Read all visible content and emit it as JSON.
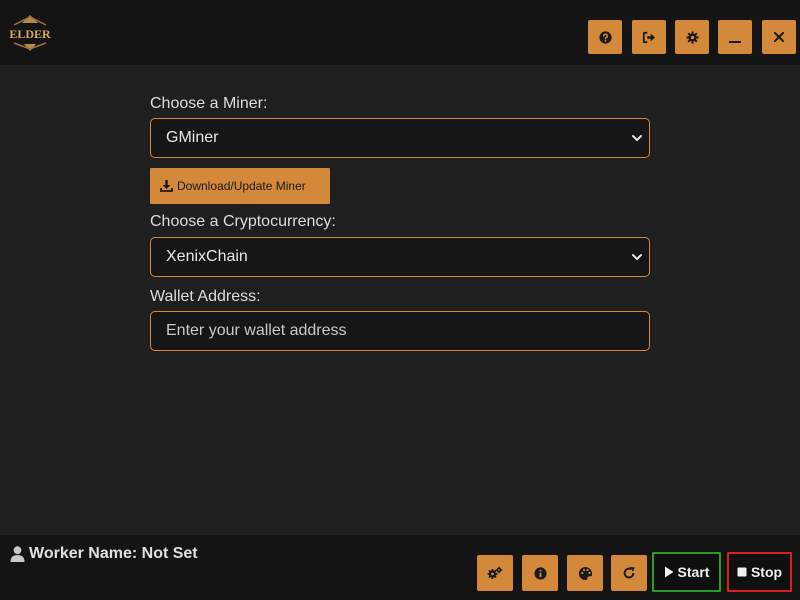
{
  "header": {
    "logo_text": "ELDER",
    "buttons": [
      {
        "name": "help",
        "icon": "question-circle-icon"
      },
      {
        "name": "logout",
        "icon": "sign-out-icon"
      },
      {
        "name": "settings",
        "icon": "gear-icon"
      },
      {
        "name": "minimize",
        "icon": "minimize-icon"
      },
      {
        "name": "close",
        "icon": "close-icon"
      }
    ]
  },
  "form": {
    "miner_label": "Choose a Miner:",
    "miner_value": "GMiner",
    "download_button": "Download/Update Miner",
    "crypto_label": "Choose a Cryptocurrency:",
    "crypto_value": "XenixChain",
    "wallet_label": "Wallet Address:",
    "wallet_placeholder": "Enter your wallet address",
    "wallet_value": ""
  },
  "footer": {
    "worker_label": "Worker Name: Not Set",
    "tool_buttons": [
      {
        "name": "advanced-settings",
        "icon": "gears-icon"
      },
      {
        "name": "info",
        "icon": "info-circle-icon"
      },
      {
        "name": "theme",
        "icon": "palette-icon"
      },
      {
        "name": "refresh",
        "icon": "redo-icon"
      }
    ],
    "start_label": "Start",
    "stop_label": "Stop"
  },
  "colors": {
    "accent": "#d4883a",
    "background": "#1f1f1f",
    "bar": "#141414",
    "start_border": "#2e9a2e",
    "stop_border": "#d81f1f"
  }
}
